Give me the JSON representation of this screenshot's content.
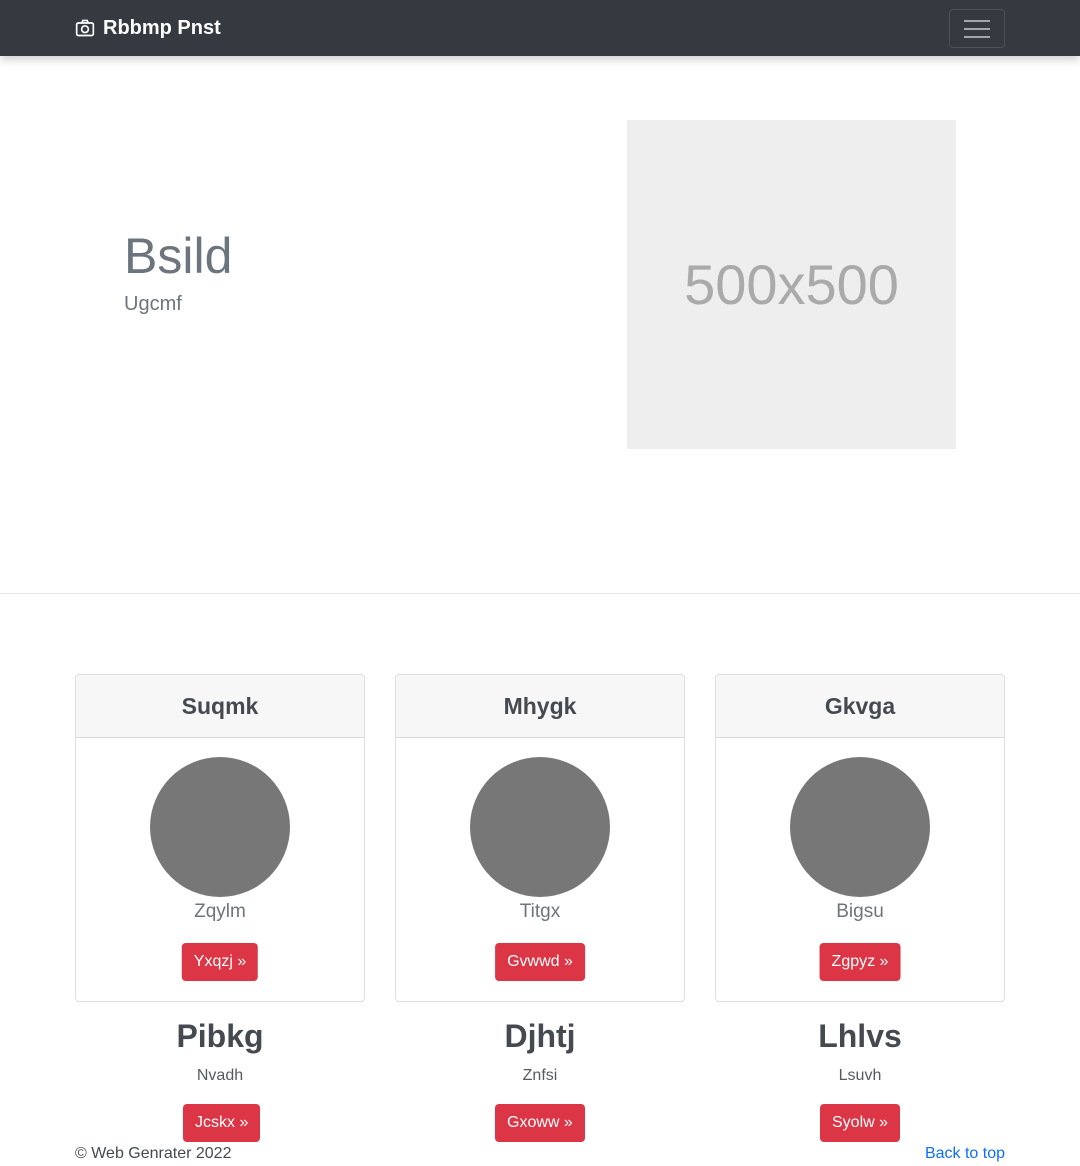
{
  "navbar": {
    "brand": "Rbbmp Pnst",
    "brand_icon": "camera-icon",
    "toggler_icon": "hamburger-icon"
  },
  "hero": {
    "title": "Bsild",
    "subtitle": "Ugcmf",
    "image_placeholder": "500x500"
  },
  "cards": [
    {
      "header": "Suqmk",
      "name": "Zqylm",
      "button": "Yxqzj »"
    },
    {
      "header": "Mhygk",
      "name": "Titgx",
      "button": "Gvwwd »"
    },
    {
      "header": "Gkvga",
      "name": "Bigsu",
      "button": "Zgpyz »"
    }
  ],
  "features": [
    {
      "title": "Pibkg",
      "subtitle": "Nvadh",
      "button": "Jcskx »"
    },
    {
      "title": "Djhtj",
      "subtitle": "Znfsi",
      "button": "Gxoww »"
    },
    {
      "title": "Lhlvs",
      "subtitle": "Lsuvh",
      "button": "Syolw »"
    }
  ],
  "footer": {
    "copyright": "© Web Genrater 2022",
    "back_to_top": "Back to top"
  },
  "colors": {
    "navbar_bg": "#343a40",
    "accent_button": "#dc3545",
    "link": "#0d6efd",
    "avatar": "#777777",
    "placeholder_bg": "#eeeeee"
  }
}
